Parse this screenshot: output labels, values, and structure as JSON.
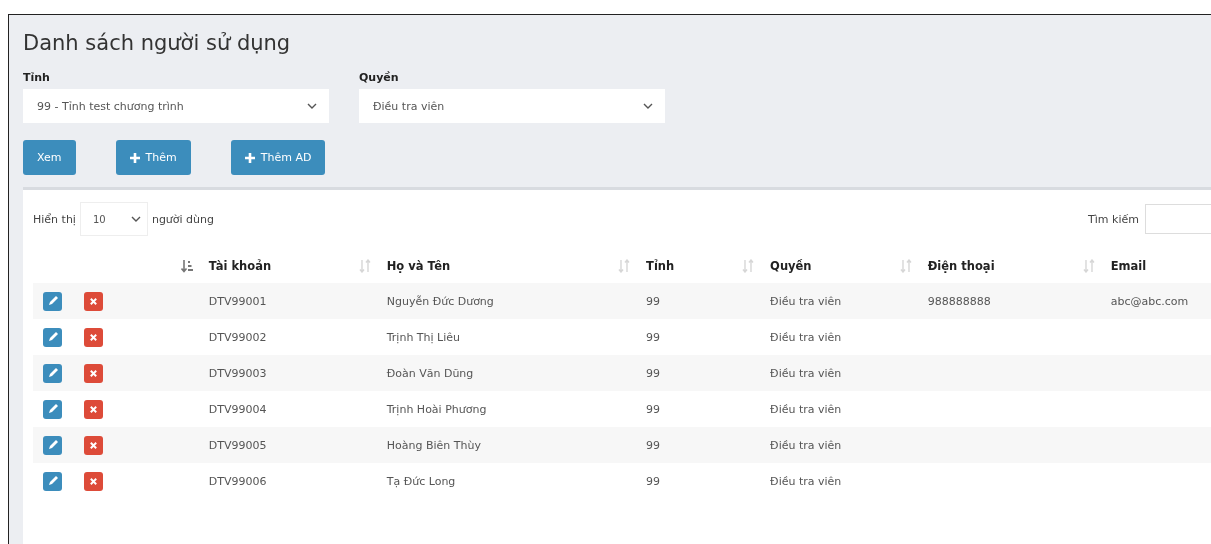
{
  "title": "Danh sách người sử dụng",
  "filters": [
    {
      "label": "Tỉnh",
      "value": "99 - Tỉnh test chương trình"
    },
    {
      "label": "Quyền",
      "value": "Điều tra viên"
    }
  ],
  "buttons": [
    {
      "label": "Xem",
      "kind": "plain"
    },
    {
      "label": "Thêm",
      "kind": "add"
    },
    {
      "label": "Thêm AD",
      "kind": "add"
    }
  ],
  "length": {
    "prefix": "Hiển thị",
    "value": "10",
    "suffix": "người dùng"
  },
  "search": {
    "label": "Tìm kiếm"
  },
  "table": {
    "columns": [
      {
        "sorted": true
      },
      {
        "label": "Tài khoản",
        "sorted": false
      },
      {
        "label": "Họ và Tên",
        "sorted": false
      },
      {
        "label": "Tỉnh",
        "sorted": false
      },
      {
        "label": "Quyền",
        "sorted": false
      },
      {
        "label": "Điện thoại",
        "sorted": false
      },
      {
        "label": "Email"
      }
    ],
    "rows": [
      {
        "account": "DTV99001",
        "name": "Nguyễn Đức Dương",
        "province": "99",
        "role": "Điều tra viên",
        "phone": "988888888",
        "email": "abc@abc.com"
      },
      {
        "account": "DTV99002",
        "name": "Trịnh Thị Liêu",
        "province": "99",
        "role": "Điều tra viên"
      },
      {
        "account": "DTV99003",
        "name": "Đoàn Văn Dũng",
        "province": "99",
        "role": "Điều tra viên"
      },
      {
        "account": "DTV99004",
        "name": "Trịnh Hoài Phương",
        "province": "99",
        "role": "Điều tra viên"
      },
      {
        "account": "DTV99005",
        "name": "Hoàng Biên Thùy",
        "province": "99",
        "role": "Điều tra viên"
      },
      {
        "account": "DTV99006",
        "name": "Tạ Đức Long",
        "province": "99",
        "role": "Điều tra viên"
      }
    ]
  }
}
